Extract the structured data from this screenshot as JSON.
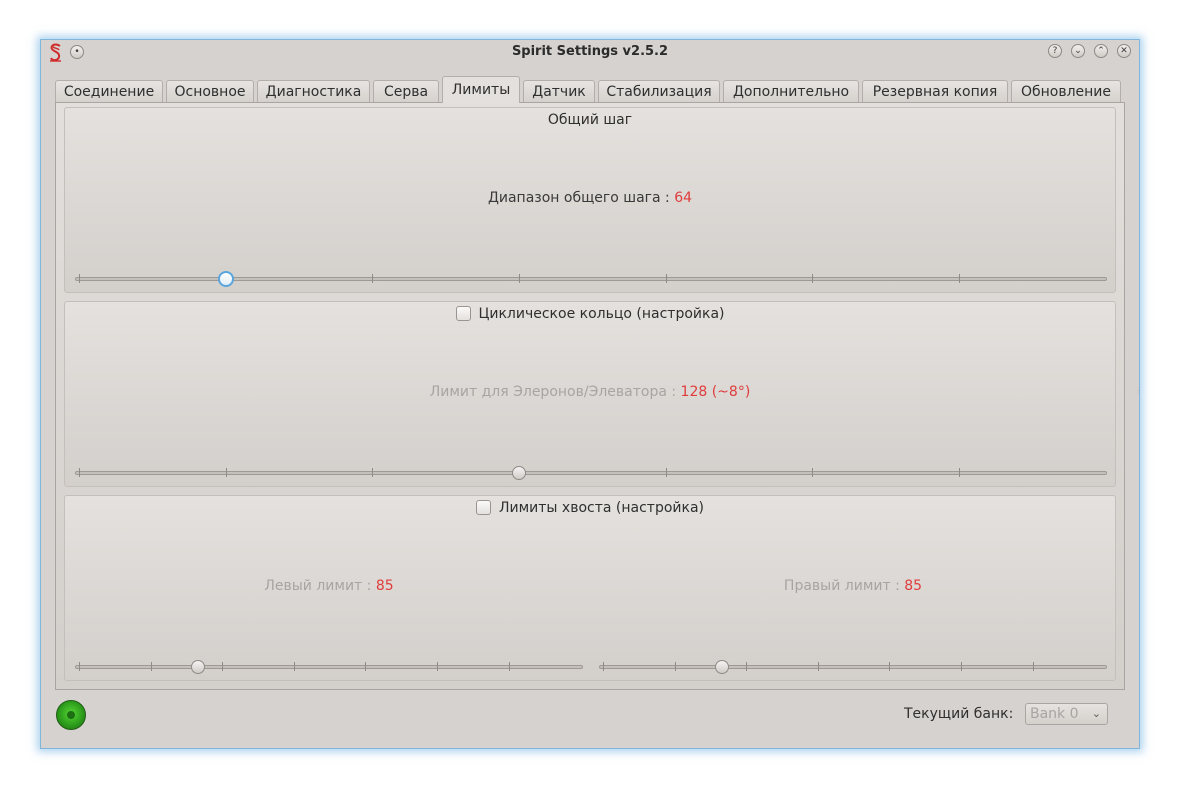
{
  "window": {
    "title": "Spirit Settings v2.5.2"
  },
  "titlebar_buttons": [
    "help-icon",
    "minimize-icon",
    "maximize-icon",
    "close-icon"
  ],
  "tabs": [
    {
      "label": "Соединение"
    },
    {
      "label": "Основное"
    },
    {
      "label": "Диагностика"
    },
    {
      "label": "Серва"
    },
    {
      "label": "Лимиты",
      "active": true
    },
    {
      "label": "Датчик"
    },
    {
      "label": "Стабилизация"
    },
    {
      "label": "Дополнительно"
    },
    {
      "label": "Резервная копия"
    },
    {
      "label": "Обновление"
    }
  ],
  "collective": {
    "title": "Общий шаг",
    "range_label": "Диапазон общего шага : ",
    "range_value": "64"
  },
  "cyclic": {
    "title": "Циклическое кольцо (настройка)",
    "checked": false,
    "limit_label": "Лимит для Элеронов/Элеватора : ",
    "limit_value": "128 (~8°)"
  },
  "tail": {
    "title": "Лимиты хвоста (настройка)",
    "checked": false,
    "left_label": "Левый лимит : ",
    "left_value": "85",
    "right_label": "Правый лимит : ",
    "right_value": "85"
  },
  "status": {
    "bank_label": "Текущий банк:",
    "bank_value": "Bank 0"
  },
  "colors": {
    "value_text": "#e03c3c",
    "focus": "#5aa6dc",
    "status_led": "#2d9d1c"
  }
}
